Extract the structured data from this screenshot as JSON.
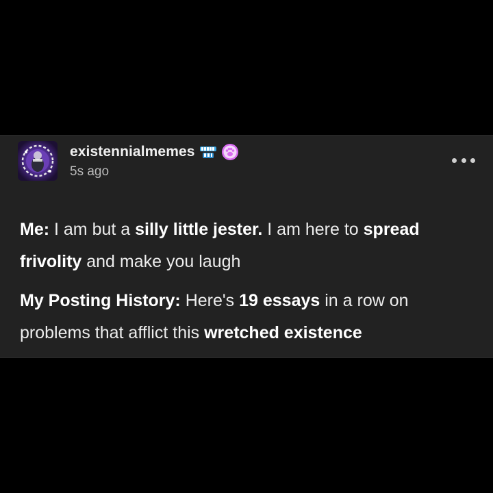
{
  "post": {
    "author": {
      "username": "existennialmemes",
      "timestamp": "5s ago",
      "avatar_icon": "jester-avatar-icon",
      "badges": [
        "teeth-badge-icon",
        "paw-badge-icon"
      ]
    },
    "more_icon": "ellipsis-icon",
    "paragraph1": {
      "s1_bold": "Me:",
      "s2": " I am but a ",
      "s3_bold": "silly little jester.",
      "s4": " I am here to ",
      "s5_bold": "spread frivolity",
      "s6": " and make you laugh"
    },
    "paragraph2": {
      "s1_bold": "My Posting History:",
      "s2": " Here's ",
      "s3_bold": "19 essays",
      "s4": " in a row on problems that afflict this ",
      "s5_bold": "wretched existence"
    }
  },
  "colors": {
    "background": "#000000",
    "card": "#222222",
    "text": "#ececec",
    "muted": "#b9b9b9",
    "badge_pink": "#d86cf0"
  }
}
